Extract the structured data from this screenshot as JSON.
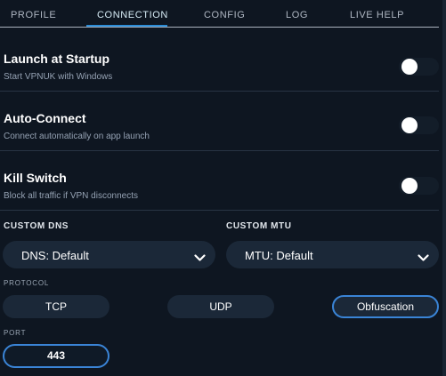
{
  "tabs": [
    {
      "label": "PROFILE"
    },
    {
      "label": "CONNECTION"
    },
    {
      "label": "CONFIG"
    },
    {
      "label": "LOG"
    },
    {
      "label": "LIVE HELP"
    }
  ],
  "active_tab": "CONNECTION",
  "settings": {
    "startup": {
      "title": "Launch at Startup",
      "desc": "Start VPNUK with Windows",
      "enabled": false
    },
    "autoconnect": {
      "title": "Auto-Connect",
      "desc": "Connect automatically on app launch",
      "enabled": false
    },
    "killswitch": {
      "title": "Kill Switch",
      "desc": "Block all traffic if VPN disconnects",
      "enabled": false
    }
  },
  "dns": {
    "label": "CUSTOM DNS",
    "value": "DNS: Default"
  },
  "mtu": {
    "label": "CUSTOM MTU",
    "value": "MTU: Default"
  },
  "protocol": {
    "label": "PROTOCOL",
    "options": [
      "TCP",
      "UDP",
      "Obfuscation"
    ],
    "selected": "Obfuscation"
  },
  "port": {
    "label": "PORT",
    "value": "443"
  },
  "colors": {
    "accent": "#3a84d6",
    "background": "#0e1621",
    "control": "#1b2838"
  },
  "icons": {
    "dropdown": "chevron-down-icon"
  }
}
